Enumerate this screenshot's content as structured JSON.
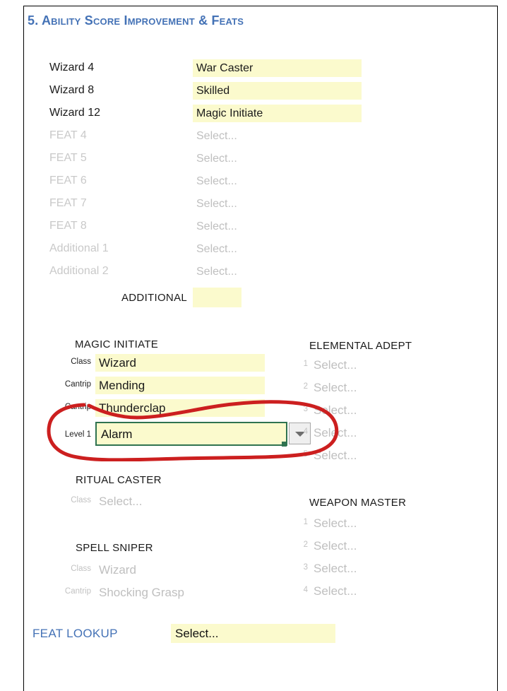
{
  "page": {
    "section_number": "5.",
    "section_title": "Ability Score Improvement & Feats",
    "heading_color": "#4472B6",
    "highlight_color": "#FBFACD",
    "active_border_color": "#2F7350",
    "annotation_color": "#CC1F1F"
  },
  "feat_rows": [
    {
      "label": "Wizard 4",
      "value": "War Caster",
      "label_state": "active",
      "value_state": "filled"
    },
    {
      "label": "Wizard 8",
      "value": "Skilled",
      "label_state": "active",
      "value_state": "filled"
    },
    {
      "label": "Wizard 12",
      "value": "Magic Initiate",
      "label_state": "active",
      "value_state": "filled"
    },
    {
      "label": "FEAT 4",
      "value": "Select...",
      "label_state": "disabled",
      "value_state": "empty"
    },
    {
      "label": "FEAT 5",
      "value": "Select...",
      "label_state": "disabled",
      "value_state": "empty"
    },
    {
      "label": "FEAT 6",
      "value": "Select...",
      "label_state": "disabled",
      "value_state": "empty"
    },
    {
      "label": "FEAT 7",
      "value": "Select...",
      "label_state": "disabled",
      "value_state": "empty"
    },
    {
      "label": "FEAT 8",
      "value": "Select...",
      "label_state": "disabled",
      "value_state": "empty"
    },
    {
      "label": "Additional 1",
      "value": "Select...",
      "label_state": "disabled",
      "value_state": "empty"
    },
    {
      "label": "Additional 2",
      "value": "Select...",
      "label_state": "disabled",
      "value_state": "empty"
    }
  ],
  "additional": {
    "label": "ADDITIONAL",
    "value": ""
  },
  "magic_initiate": {
    "title": "MAGIC INITIATE",
    "rows": [
      {
        "caption": "Class",
        "value": "Wizard",
        "state": "filled"
      },
      {
        "caption": "Cantrip",
        "value": "Mending",
        "state": "filled"
      },
      {
        "caption": "Cantrip",
        "value": "Thunderclap",
        "state": "filled"
      }
    ],
    "active_row": {
      "caption": "Level 1",
      "value": "Alarm"
    }
  },
  "elemental_adept": {
    "title": "ELEMENTAL ADEPT",
    "rows": [
      {
        "num": "1",
        "value": "Select..."
      },
      {
        "num": "2",
        "value": "Select..."
      },
      {
        "num": "3",
        "value": "Select..."
      },
      {
        "num": "4",
        "value": "Select..."
      },
      {
        "num": "5",
        "value": "Select..."
      }
    ]
  },
  "ritual_caster": {
    "title": "RITUAL CASTER",
    "rows": [
      {
        "caption": "Class",
        "value": "Select...",
        "state": "empty"
      }
    ]
  },
  "spell_sniper": {
    "title": "SPELL SNIPER",
    "rows": [
      {
        "caption": "Class",
        "value": "Wizard",
        "state": "disabled"
      },
      {
        "caption": "Cantrip",
        "value": "Shocking Grasp",
        "state": "disabled"
      }
    ]
  },
  "weapon_master": {
    "title": "WEAPON MASTER",
    "rows": [
      {
        "num": "1",
        "value": "Select..."
      },
      {
        "num": "2",
        "value": "Select..."
      },
      {
        "num": "3",
        "value": "Select..."
      },
      {
        "num": "4",
        "value": "Select..."
      }
    ]
  },
  "feat_lookup": {
    "label": "FEAT LOOKUP",
    "value": "Select..."
  },
  "icons": {
    "dropdown_arrow": "chevron-down-icon",
    "annotation": "hand-drawn-circle-annotation"
  }
}
